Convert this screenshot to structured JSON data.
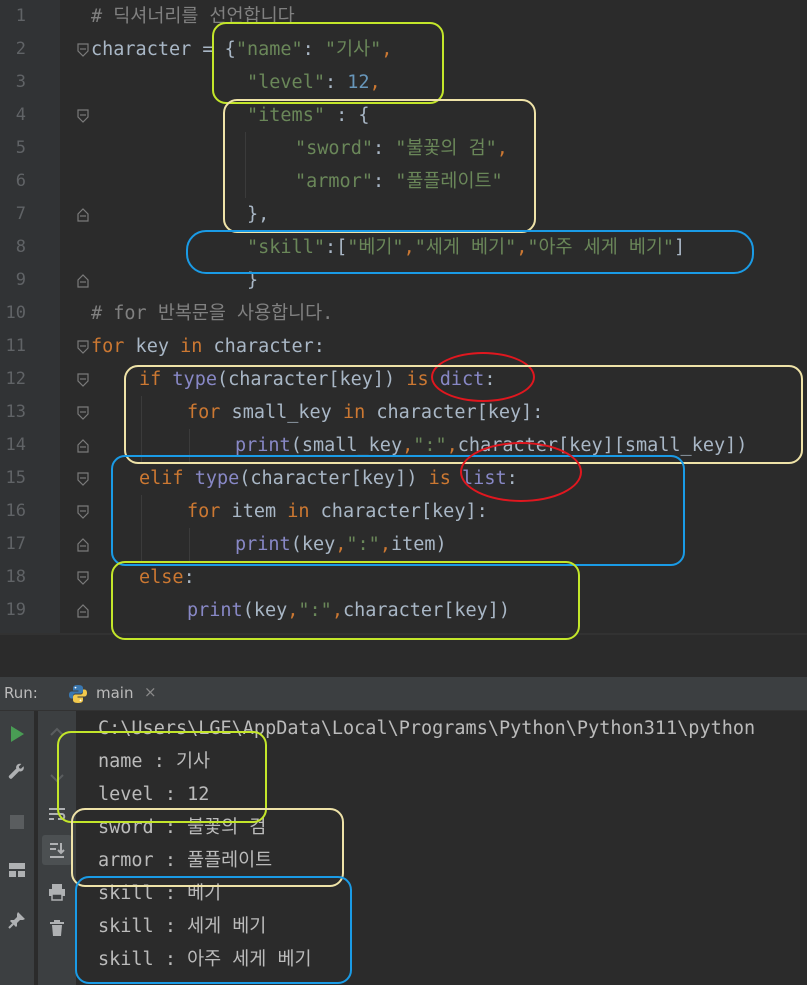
{
  "editor": {
    "line_numbers": [
      "1",
      "2",
      "3",
      "4",
      "5",
      "6",
      "7",
      "8",
      "9",
      "10",
      "11",
      "12",
      "13",
      "14",
      "15",
      "16",
      "17",
      "18",
      "19"
    ],
    "comment1": "# 딕셔너리를 선언합니다",
    "l2_var": "character",
    "l2_eq": " = {",
    "l2_key": "\"name\"",
    "l2_colon": ": ",
    "l2_val": "\"기사\"",
    "l2_comma": ",",
    "l3_key": "\"level\"",
    "l3_colon": ": ",
    "l3_val": "12",
    "l3_comma": ",",
    "l4_key": "\"items\"",
    "l4_rest": " : {",
    "l5_key": "\"sword\"",
    "l5_colon": ": ",
    "l5_val": "\"불꽃의 검\"",
    "l5_comma": ",",
    "l6_key": "\"armor\"",
    "l6_colon": ": ",
    "l6_val": "\"풀플레이트\"",
    "l7": "},",
    "l8_key": "\"skill\"",
    "l8_colon": ":[",
    "l8_v1": "\"베기\"",
    "l8_c1": ",",
    "l8_v2": "\"세게 베기\"",
    "l8_c2": ",",
    "l8_v3": "\"아주 세게 베기\"",
    "l8_end": "]",
    "l9": "}",
    "comment2": "# for 반복문을 사용합니다.",
    "l11_for": "for",
    "l11_key": " key ",
    "l11_in": "in",
    "l11_rest": " character:",
    "l12_if": "if",
    "l12_type": "type",
    "l12_mid": "(character[key]) ",
    "l12_is": "is",
    "l12_dict": "dict",
    "l12_end": ":",
    "l13_for": "for",
    "l13_mid": " small_key ",
    "l13_in": "in",
    "l13_rest": " character[key]:",
    "l14_print": "print",
    "l14_a": "(small_key",
    "l14_c1": ",",
    "l14_str": "\":\"",
    "l14_c2": ",",
    "l14_b": "character[key][small_key])",
    "l15_elif": "elif",
    "l15_type": "type",
    "l15_mid": "(character[key]) ",
    "l15_is": "is",
    "l15_list": "list",
    "l15_end": ":",
    "l16_for": "for",
    "l16_mid": " item ",
    "l16_in": "in",
    "l16_rest": " character[key]:",
    "l17_print": "print",
    "l17_a": "(key",
    "l17_c1": ",",
    "l17_str": "\":\"",
    "l17_c2": ",",
    "l17_b": "item)",
    "l18_else": "else",
    "l18_end": ":",
    "l19_print": "print",
    "l19_a": "(key",
    "l19_c1": ",",
    "l19_str": "\":\"",
    "l19_c2": ",",
    "l19_b": "character[key])"
  },
  "run_panel": {
    "label": "Run:",
    "tab_label": "main",
    "tab_close": "×",
    "tab_icon": "python-icon"
  },
  "console": {
    "lines": [
      "C:\\Users\\LGE\\AppData\\Local\\Programs\\Python\\Python311\\python",
      "name : 기사",
      "level : 12",
      "sword : 불꽃의 검",
      "armor : 풀플레이트",
      "skill : 베기",
      "skill : 세게 베기",
      "skill : 아주 세게 베기"
    ]
  },
  "colors": {
    "annotation_green": "#c3e62a",
    "annotation_yellow": "#efe3a8",
    "annotation_blue": "#1a9be6",
    "annotation_red": "#e0171f"
  }
}
